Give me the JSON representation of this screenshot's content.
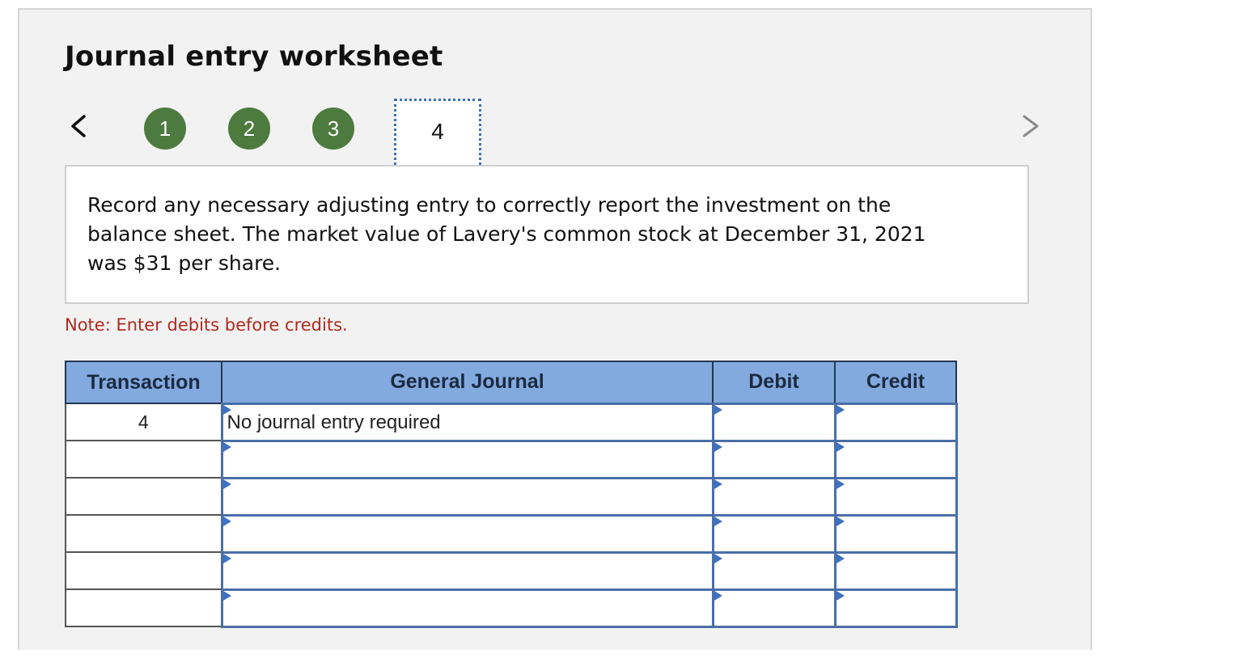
{
  "worksheet": {
    "title": "Journal entry worksheet",
    "steps": [
      "1",
      "2",
      "3",
      "4"
    ],
    "current_step": "4",
    "instruction": "Record any necessary adjusting entry to correctly report the investment on the balance sheet. The market value of Lavery's common stock at December 31, 2021 was $31 per share.",
    "note": "Note: Enter debits before credits."
  },
  "table": {
    "headers": {
      "transaction": "Transaction",
      "general_journal": "General Journal",
      "debit": "Debit",
      "credit": "Credit"
    },
    "rows": [
      {
        "transaction": "4",
        "account": "No journal entry required",
        "debit": "",
        "credit": ""
      },
      {
        "transaction": "",
        "account": "",
        "debit": "",
        "credit": ""
      },
      {
        "transaction": "",
        "account": "",
        "debit": "",
        "credit": ""
      },
      {
        "transaction": "",
        "account": "",
        "debit": "",
        "credit": ""
      },
      {
        "transaction": "",
        "account": "",
        "debit": "",
        "credit": ""
      },
      {
        "transaction": "",
        "account": "",
        "debit": "",
        "credit": ""
      }
    ]
  },
  "colors": {
    "step_complete": "#4d7a3e",
    "header_bg": "#82aadf",
    "note_text": "#b02a1e",
    "current_step_border": "#3c6fb4"
  },
  "icons": {
    "prev": "chevron-left-icon",
    "next": "chevron-right-icon",
    "dropdown": "dropdown-triangle-icon"
  }
}
